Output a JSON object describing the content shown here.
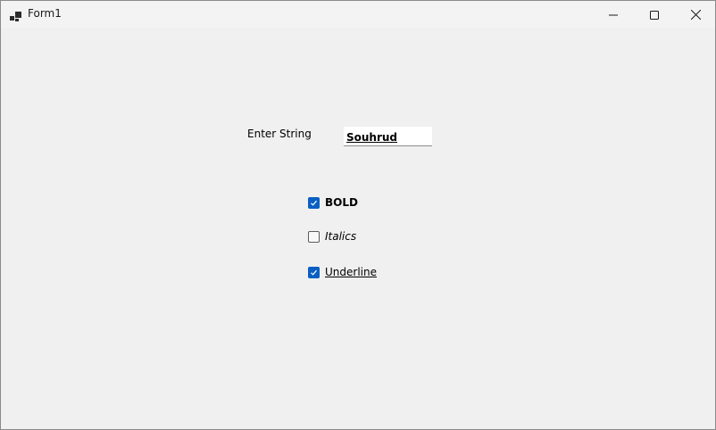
{
  "window": {
    "title": "Form1",
    "icon": "app-form-icon"
  },
  "titlebar": {
    "minimize_icon": "minimize-icon",
    "maximize_icon": "maximize-icon",
    "close_icon": "close-icon"
  },
  "form": {
    "enter_label": "Enter String",
    "input_value": "Souhrud",
    "checkboxes": [
      {
        "label": "BOLD",
        "checked": true
      },
      {
        "label": "Italics",
        "checked": false
      },
      {
        "label": "Underline",
        "checked": true
      }
    ]
  },
  "colors": {
    "accent": "#0a5fc2",
    "background": "#f0f0f0",
    "titlebar": "#f3f3f3"
  }
}
